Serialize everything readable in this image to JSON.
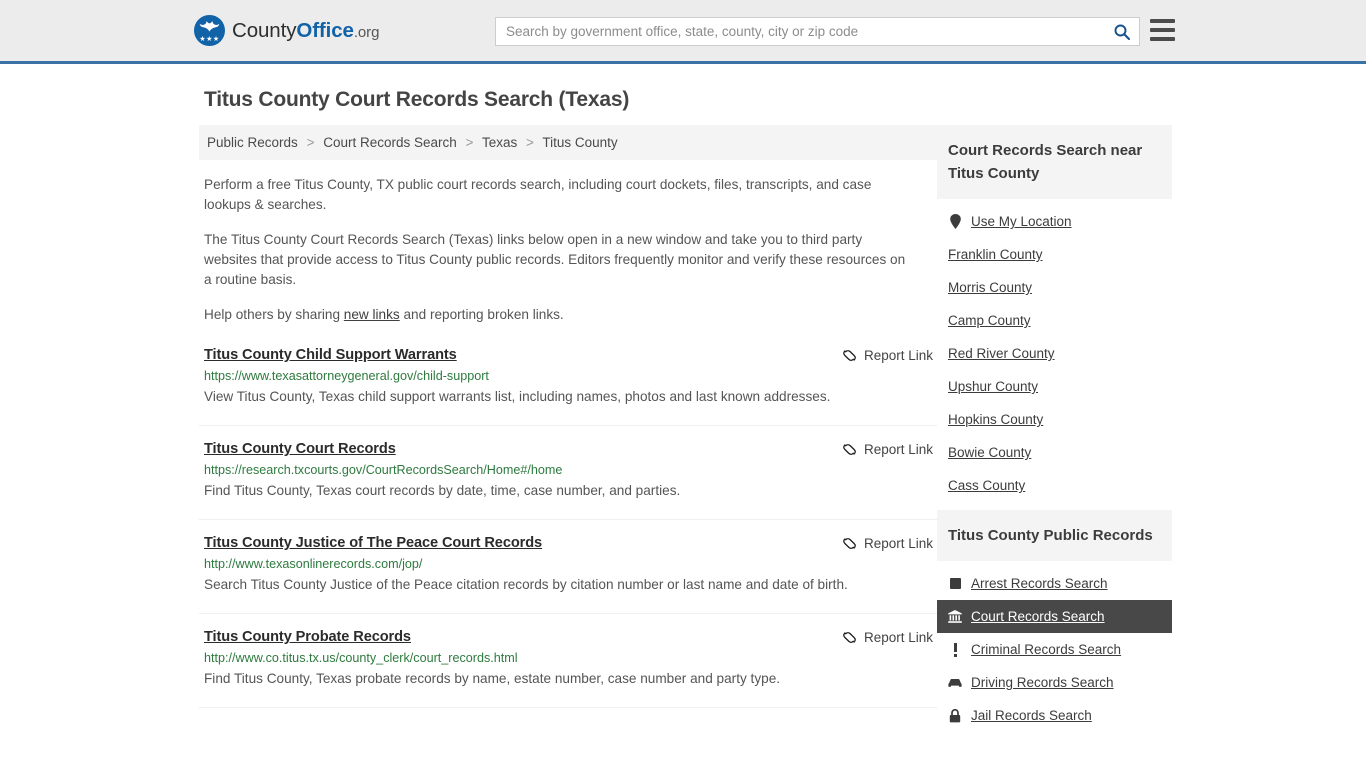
{
  "header": {
    "brand": {
      "part1": "County",
      "part2": "Office",
      "part3": ".org"
    },
    "search": {
      "placeholder": "Search by government office, state, county, city or zip code",
      "value": "",
      "button_icon": "search-icon"
    },
    "menu_icon": "hamburger-menu-icon",
    "accent_color": "#3a72a8"
  },
  "page_title": "Titus County Court Records Search (Texas)",
  "breadcrumb": {
    "separator": ">",
    "items": [
      {
        "label": "Public Records"
      },
      {
        "label": "Court Records Search"
      },
      {
        "label": "Texas"
      },
      {
        "label": "Titus County"
      }
    ]
  },
  "intro": {
    "p1": "Perform a free Titus County, TX public court records search, including court dockets, files, transcripts, and case lookups & searches.",
    "p2": "The Titus County Court Records Search (Texas) links below open in a new window and take you to third party websites that provide access to Titus County public records. Editors frequently monitor and verify these resources on a routine basis.",
    "p3_before": "Help others by sharing ",
    "p3_link": "new links",
    "p3_after": " and reporting broken links."
  },
  "report_link_label": "Report Link",
  "report_link_icon": "broken-link-icon",
  "results": [
    {
      "title": "Titus County Child Support Warrants",
      "url": "https://www.texasattorneygeneral.gov/child-support",
      "description": "View Titus County, Texas child support warrants list, including names, photos and last known addresses."
    },
    {
      "title": "Titus County Court Records",
      "url": "https://research.txcourts.gov/CourtRecordsSearch/Home#/home",
      "description": "Find Titus County, Texas court records by date, time, case number, and parties."
    },
    {
      "title": "Titus County Justice of The Peace Court Records",
      "url": "http://www.texasonlinerecords.com/jop/",
      "description": "Search Titus County Justice of the Peace citation records by citation number or last name and date of birth."
    },
    {
      "title": "Titus County Probate Records",
      "url": "http://www.co.titus.tx.us/county_clerk/court_records.html",
      "description": "Find Titus County, Texas probate records by name, estate number, case number and party type."
    }
  ],
  "sidebar": {
    "nearby": {
      "heading": "Court Records Search near Titus County",
      "items": [
        {
          "label": "Use My Location",
          "icon": "map-pin-icon"
        },
        {
          "label": "Franklin County",
          "icon": ""
        },
        {
          "label": "Morris County",
          "icon": ""
        },
        {
          "label": "Camp County",
          "icon": ""
        },
        {
          "label": "Red River County",
          "icon": ""
        },
        {
          "label": "Upshur County",
          "icon": ""
        },
        {
          "label": "Hopkins County",
          "icon": ""
        },
        {
          "label": "Bowie County",
          "icon": ""
        },
        {
          "label": "Cass County",
          "icon": ""
        }
      ]
    },
    "public_records": {
      "heading": "Titus County Public Records",
      "active_index": 1,
      "items": [
        {
          "label": "Arrest Records Search",
          "icon": "fingerprint-square-icon"
        },
        {
          "label": "Court Records Search",
          "icon": "courthouse-icon"
        },
        {
          "label": "Criminal Records Search",
          "icon": "exclamation-icon"
        },
        {
          "label": "Driving Records Search",
          "icon": "car-icon"
        },
        {
          "label": "Jail Records Search",
          "icon": "lock-icon"
        }
      ]
    }
  }
}
